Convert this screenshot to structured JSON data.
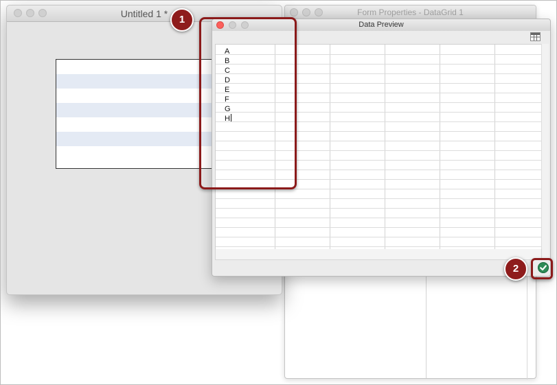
{
  "windows": {
    "untitled": {
      "title": "Untitled 1 *"
    },
    "form_properties": {
      "title": "Form Properties - DataGrid 1"
    },
    "data_preview": {
      "title": "Data Preview"
    }
  },
  "data_preview": {
    "cells": [
      "A",
      "B",
      "C",
      "D",
      "E",
      "F",
      "G",
      "H"
    ],
    "toolbar_icon": "table-icon",
    "ok_icon": "checkmark-icon"
  },
  "annotations": {
    "step1": "1",
    "step2": "2"
  },
  "colors": {
    "annotation": "#8e1c1c",
    "stripe": "#e4eaf4",
    "ok_button": "#2e8b57"
  }
}
